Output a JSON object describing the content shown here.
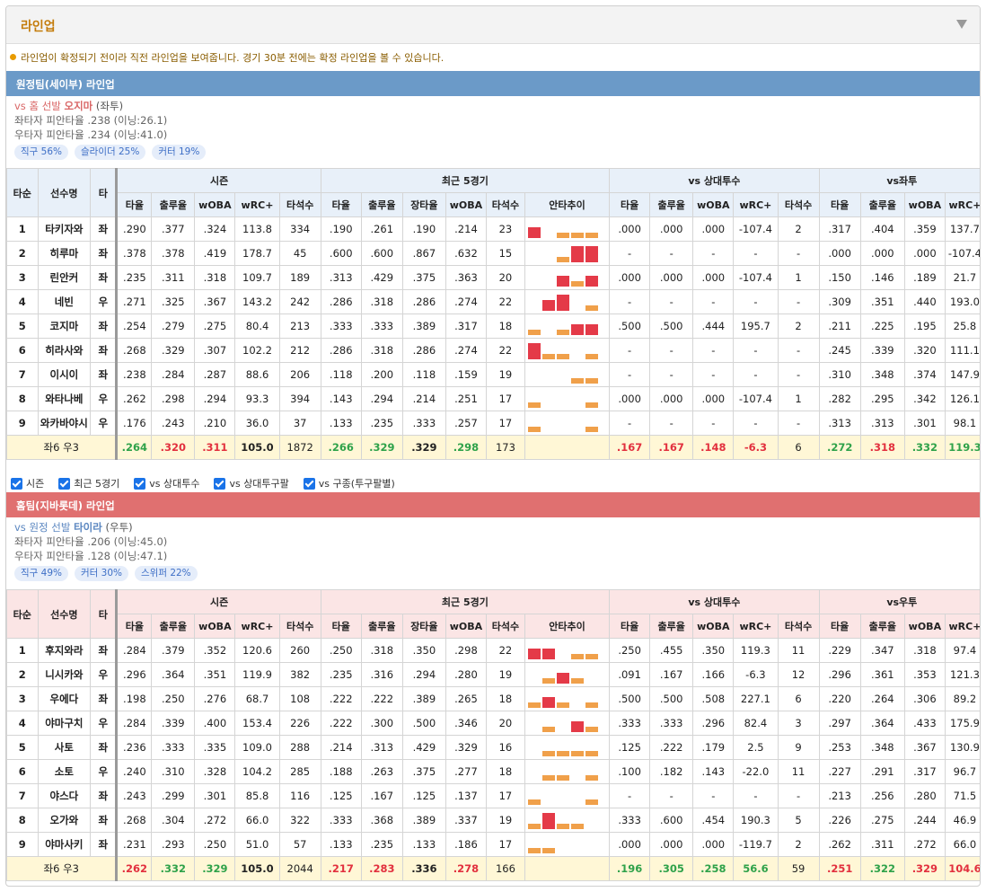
{
  "panel": {
    "title": "라인업"
  },
  "notice": "라인업이 확정되기 전이라 직전 라인업을 보여줍니다. 경기 30분 전에는 확정 라인업을 볼 수 있습니다.",
  "colors": {
    "away_bar": "#6b9ac8",
    "home_bar": "#e07070",
    "hi_bar": "#e43a48",
    "lo_bar": "#f0a04a"
  },
  "headers": {
    "order": "타순",
    "name": "선수명",
    "hand": "타",
    "season": "시즌",
    "recent": "최근 5경기",
    "vs_pitcher": "vs 상대투수",
    "cols_season": [
      "타율",
      "출루율",
      "wOBA",
      "wRC+",
      "타석수"
    ],
    "cols_recent": [
      "타율",
      "출루율",
      "장타율",
      "wOBA",
      "타석수",
      "안타추이"
    ],
    "cols_vs": [
      "타율",
      "출루율",
      "wOBA",
      "wRC+",
      "타석수"
    ],
    "cols_split": [
      "타율",
      "출루율",
      "wOBA",
      "wRC+"
    ]
  },
  "options": [
    "시즌",
    "최근 5경기",
    "vs 상대투수",
    "vs 상대투구팔",
    "vs 구종(투구팔별)"
  ],
  "away": {
    "bar_title": "원정팀(세이부) 라인업",
    "starter_prefix": "vs 홈 선발",
    "starter_name": "오지마",
    "starter_hand": "(좌투)",
    "split_left": "좌타자 피안타율 .238 (이닝:26.1)",
    "split_right": "우타자 피안타율 .234 (이닝:41.0)",
    "pitch_tags": [
      "직구 56%",
      "슬라이더 25%",
      "커터 19%"
    ],
    "split_header": "vs좌투",
    "players": [
      {
        "order": "1",
        "name": "타키자와",
        "hand": "좌",
        "season": [
          ".290",
          ".377",
          ".324",
          "113.8",
          "334"
        ],
        "recent": [
          ".190",
          ".261",
          ".190",
          ".214",
          "23"
        ],
        "trend": [
          2,
          0,
          1,
          1,
          1
        ],
        "vs": [
          ".000",
          ".000",
          ".000",
          "-107.4",
          "2"
        ],
        "split": [
          ".317",
          ".404",
          ".359",
          "137.7"
        ]
      },
      {
        "order": "2",
        "name": "히루마",
        "hand": "좌",
        "season": [
          ".378",
          ".378",
          ".419",
          "178.7",
          "45"
        ],
        "recent": [
          ".600",
          ".600",
          ".867",
          ".632",
          "15"
        ],
        "trend": [
          0,
          0,
          1,
          3,
          3
        ],
        "vs": [
          "-",
          "-",
          "-",
          "-",
          "-"
        ],
        "split": [
          ".000",
          ".000",
          ".000",
          "-107.4"
        ]
      },
      {
        "order": "3",
        "name": "린안커",
        "hand": "좌",
        "season": [
          ".235",
          ".311",
          ".318",
          "109.7",
          "189"
        ],
        "recent": [
          ".313",
          ".429",
          ".375",
          ".363",
          "20"
        ],
        "trend": [
          0,
          0,
          2,
          1,
          2
        ],
        "vs": [
          ".000",
          ".000",
          ".000",
          "-107.4",
          "1"
        ],
        "split": [
          ".150",
          ".146",
          ".189",
          "21.7"
        ]
      },
      {
        "order": "4",
        "name": "네빈",
        "hand": "우",
        "season": [
          ".271",
          ".325",
          ".367",
          "143.2",
          "242"
        ],
        "recent": [
          ".286",
          ".318",
          ".286",
          ".274",
          "22"
        ],
        "trend": [
          0,
          2,
          3,
          0,
          1
        ],
        "vs": [
          "-",
          "-",
          "-",
          "-",
          "-"
        ],
        "split": [
          ".309",
          ".351",
          ".440",
          "193.0"
        ]
      },
      {
        "order": "5",
        "name": "코지마",
        "hand": "좌",
        "season": [
          ".254",
          ".279",
          ".275",
          "80.4",
          "213"
        ],
        "recent": [
          ".333",
          ".333",
          ".389",
          ".317",
          "18"
        ],
        "trend": [
          1,
          0,
          1,
          2,
          2
        ],
        "vs": [
          ".500",
          ".500",
          ".444",
          "195.7",
          "2"
        ],
        "split": [
          ".211",
          ".225",
          ".195",
          "25.8"
        ]
      },
      {
        "order": "6",
        "name": "히라사와",
        "hand": "좌",
        "season": [
          ".268",
          ".329",
          ".307",
          "102.2",
          "212"
        ],
        "recent": [
          ".286",
          ".318",
          ".286",
          ".274",
          "22"
        ],
        "trend": [
          3,
          1,
          1,
          0,
          1
        ],
        "vs": [
          "-",
          "-",
          "-",
          "-",
          "-"
        ],
        "split": [
          ".245",
          ".339",
          ".320",
          "111.1"
        ]
      },
      {
        "order": "7",
        "name": "이시이",
        "hand": "좌",
        "season": [
          ".238",
          ".284",
          ".287",
          "88.6",
          "206"
        ],
        "recent": [
          ".118",
          ".200",
          ".118",
          ".159",
          "19"
        ],
        "trend": [
          0,
          0,
          0,
          1,
          1
        ],
        "vs": [
          "-",
          "-",
          "-",
          "-",
          "-"
        ],
        "split": [
          ".310",
          ".348",
          ".374",
          "147.9"
        ]
      },
      {
        "order": "8",
        "name": "와타나베",
        "hand": "우",
        "season": [
          ".262",
          ".298",
          ".294",
          "93.3",
          "394"
        ],
        "recent": [
          ".143",
          ".294",
          ".214",
          ".251",
          "17"
        ],
        "trend": [
          1,
          0,
          0,
          0,
          1
        ],
        "vs": [
          ".000",
          ".000",
          ".000",
          "-107.4",
          "1"
        ],
        "split": [
          ".282",
          ".295",
          ".342",
          "126.1"
        ]
      },
      {
        "order": "9",
        "name": "와카바야시",
        "hand": "우",
        "season": [
          ".176",
          ".243",
          ".210",
          "36.0",
          "37"
        ],
        "recent": [
          ".133",
          ".235",
          ".333",
          ".257",
          "17"
        ],
        "trend": [
          1,
          0,
          0,
          0,
          1
        ],
        "vs": [
          "-",
          "-",
          "-",
          "-",
          "-"
        ],
        "split": [
          ".313",
          ".313",
          ".301",
          "98.1"
        ]
      }
    ],
    "total": {
      "label": "좌6 우3",
      "season": [
        ".264",
        ".320",
        ".311",
        "105.0",
        "1872"
      ],
      "recent": [
        ".266",
        ".329",
        ".329",
        ".298",
        "173"
      ],
      "vs": [
        ".167",
        ".167",
        ".148",
        "-6.3",
        "6"
      ],
      "split": [
        ".272",
        ".318",
        ".332",
        "119.3"
      ]
    }
  },
  "home": {
    "bar_title": "홈팀(지바롯데) 라인업",
    "starter_prefix": "vs 원정 선발",
    "starter_name": "타이라",
    "starter_hand": "(우투)",
    "split_left": "좌타자 피안타율 .206 (이닝:45.0)",
    "split_right": "우타자 피안타율 .128 (이닝:47.1)",
    "pitch_tags": [
      "직구 49%",
      "커터 30%",
      "스위퍼 22%"
    ],
    "split_header": "vs우투",
    "players": [
      {
        "order": "1",
        "name": "후지와라",
        "hand": "좌",
        "season": [
          ".284",
          ".379",
          ".352",
          "120.6",
          "260"
        ],
        "recent": [
          ".250",
          ".318",
          ".350",
          ".298",
          "22"
        ],
        "trend": [
          2,
          2,
          0,
          1,
          1
        ],
        "vs": [
          ".250",
          ".455",
          ".350",
          "119.3",
          "11"
        ],
        "split": [
          ".229",
          ".347",
          ".318",
          "97.4"
        ]
      },
      {
        "order": "2",
        "name": "니시카와",
        "hand": "우",
        "season": [
          ".296",
          ".364",
          ".351",
          "119.9",
          "382"
        ],
        "recent": [
          ".235",
          ".316",
          ".294",
          ".280",
          "19"
        ],
        "trend": [
          0,
          1,
          2,
          1,
          0
        ],
        "vs": [
          ".091",
          ".167",
          ".166",
          "-6.3",
          "12"
        ],
        "split": [
          ".296",
          ".361",
          ".353",
          "121.3"
        ]
      },
      {
        "order": "3",
        "name": "우에다",
        "hand": "좌",
        "season": [
          ".198",
          ".250",
          ".276",
          "68.7",
          "108"
        ],
        "recent": [
          ".222",
          ".222",
          ".389",
          ".265",
          "18"
        ],
        "trend": [
          1,
          2,
          1,
          0,
          1
        ],
        "vs": [
          ".500",
          ".500",
          ".508",
          "227.1",
          "6"
        ],
        "split": [
          ".220",
          ".264",
          ".306",
          "89.2"
        ]
      },
      {
        "order": "4",
        "name": "야마구치",
        "hand": "우",
        "season": [
          ".284",
          ".339",
          ".400",
          "153.4",
          "226"
        ],
        "recent": [
          ".222",
          ".300",
          ".500",
          ".346",
          "20"
        ],
        "trend": [
          0,
          1,
          0,
          2,
          1
        ],
        "vs": [
          ".333",
          ".333",
          ".296",
          "82.4",
          "3"
        ],
        "split": [
          ".297",
          ".364",
          ".433",
          "175.9"
        ]
      },
      {
        "order": "5",
        "name": "사토",
        "hand": "좌",
        "season": [
          ".236",
          ".333",
          ".335",
          "109.0",
          "288"
        ],
        "recent": [
          ".214",
          ".313",
          ".429",
          ".329",
          "16"
        ],
        "trend": [
          0,
          1,
          1,
          1,
          1
        ],
        "vs": [
          ".125",
          ".222",
          ".179",
          "2.5",
          "9"
        ],
        "split": [
          ".253",
          ".348",
          ".367",
          "130.9"
        ]
      },
      {
        "order": "6",
        "name": "소토",
        "hand": "우",
        "season": [
          ".240",
          ".310",
          ".328",
          "104.2",
          "285"
        ],
        "recent": [
          ".188",
          ".263",
          ".375",
          ".277",
          "18"
        ],
        "trend": [
          0,
          1,
          1,
          0,
          1
        ],
        "vs": [
          ".100",
          ".182",
          ".143",
          "-22.0",
          "11"
        ],
        "split": [
          ".227",
          ".291",
          ".317",
          "96.7"
        ]
      },
      {
        "order": "7",
        "name": "야스다",
        "hand": "좌",
        "season": [
          ".243",
          ".299",
          ".301",
          "85.8",
          "116"
        ],
        "recent": [
          ".125",
          ".167",
          ".125",
          ".137",
          "17"
        ],
        "trend": [
          1,
          0,
          0,
          0,
          1
        ],
        "vs": [
          "-",
          "-",
          "-",
          "-",
          "-"
        ],
        "split": [
          ".213",
          ".256",
          ".280",
          "71.5"
        ]
      },
      {
        "order": "8",
        "name": "오가와",
        "hand": "좌",
        "season": [
          ".268",
          ".304",
          ".272",
          "66.0",
          "322"
        ],
        "recent": [
          ".333",
          ".368",
          ".389",
          ".337",
          "19"
        ],
        "trend": [
          1,
          3,
          1,
          1,
          0
        ],
        "vs": [
          ".333",
          ".600",
          ".454",
          "190.3",
          "5"
        ],
        "split": [
          ".226",
          ".275",
          ".244",
          "46.9"
        ]
      },
      {
        "order": "9",
        "name": "야마사키",
        "hand": "좌",
        "season": [
          ".231",
          ".293",
          ".250",
          "51.0",
          "57"
        ],
        "recent": [
          ".133",
          ".235",
          ".133",
          ".186",
          "17"
        ],
        "trend": [
          1,
          1,
          0,
          0,
          0
        ],
        "vs": [
          ".000",
          ".000",
          ".000",
          "-119.7",
          "2"
        ],
        "split": [
          ".262",
          ".311",
          ".272",
          "66.0"
        ]
      }
    ],
    "total": {
      "label": "좌6 우3",
      "season": [
        ".262",
        ".332",
        ".329",
        "105.0",
        "2044"
      ],
      "recent": [
        ".217",
        ".283",
        ".336",
        ".278",
        "166"
      ],
      "vs": [
        ".196",
        ".305",
        ".258",
        "56.6",
        "59"
      ],
      "split": [
        ".251",
        ".322",
        ".329",
        "104.6"
      ]
    }
  }
}
